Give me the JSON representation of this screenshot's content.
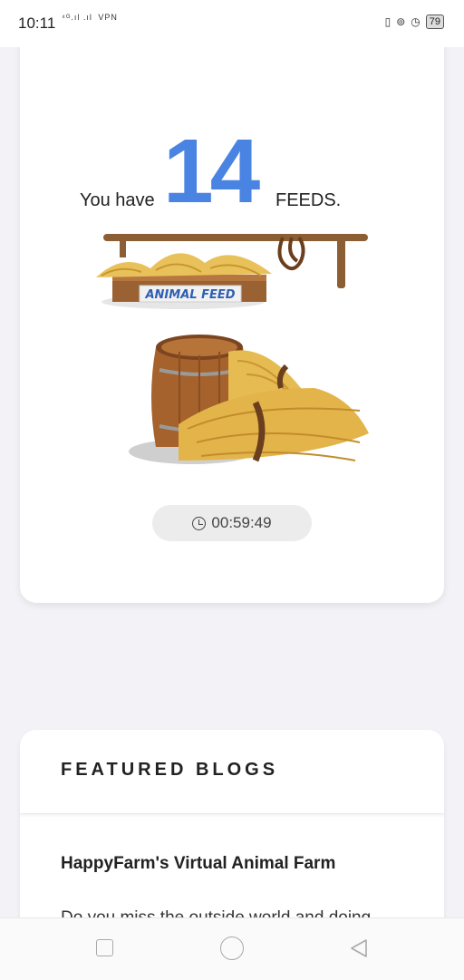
{
  "status_bar": {
    "time": "10:11",
    "signal_text": "⁴ᴳ.ıl .ıl",
    "vpn_label": "VPN",
    "right_icons": [
      "vibrate-icon",
      "lock-icon",
      "alarm-icon"
    ],
    "battery_level": "79"
  },
  "feed_card": {
    "you_have": "You have",
    "count": "14",
    "feeds_label": "FEEDS.",
    "sign_text": "ANIMAL FEED",
    "timer": "00:59:49",
    "colors": {
      "count": "#4a84e3",
      "timer_bg": "#ececec"
    }
  },
  "blogs": {
    "header": "FEATURED BLOGS",
    "items": [
      {
        "title": "HappyFarm's Virtual Animal Farm",
        "excerpt": "Do you miss the outside world and doing"
      }
    ]
  },
  "nav_bar": {
    "icons": [
      "recent-apps-icon",
      "home-icon",
      "back-icon"
    ]
  }
}
